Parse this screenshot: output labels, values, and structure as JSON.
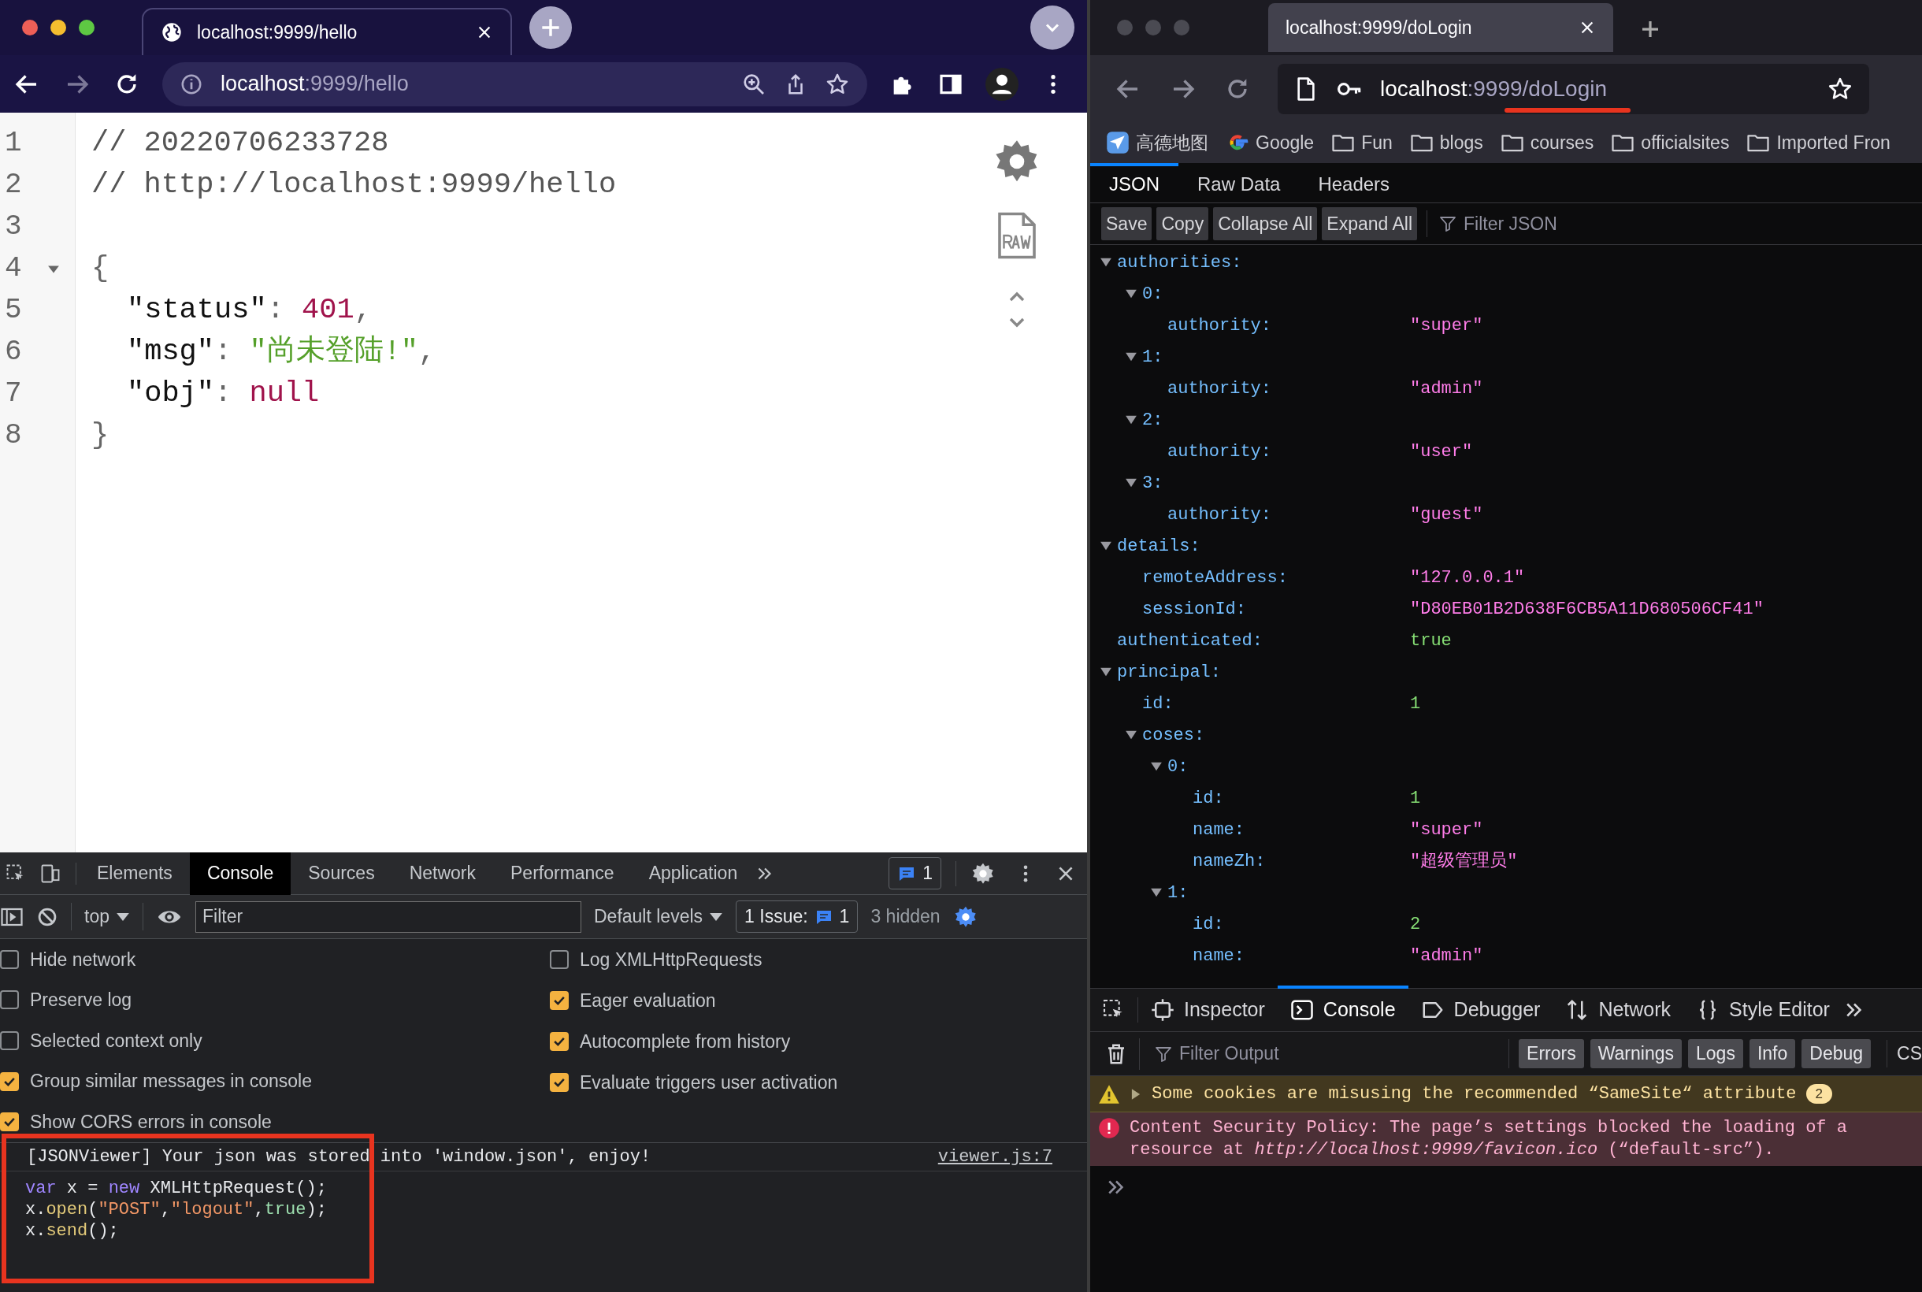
{
  "left_browser": {
    "tab": {
      "title": "localhost:9999/hello"
    },
    "address": {
      "host": "localhost",
      "path": ":9999/hello"
    },
    "viewer": {
      "lines": [
        {
          "number": "1",
          "foldable": false,
          "indented": false,
          "tokens": [
            {
              "kind": "comment",
              "text": "// 20220706233728"
            }
          ]
        },
        {
          "number": "2",
          "foldable": false,
          "indented": false,
          "tokens": [
            {
              "kind": "comment",
              "text": "// http://localhost:9999/hello"
            }
          ]
        },
        {
          "number": "3",
          "foldable": false
        },
        {
          "number": "4",
          "foldable": true,
          "indented": false,
          "tokens": [
            {
              "kind": "punct",
              "text": "{"
            }
          ]
        },
        {
          "number": "5",
          "foldable": false,
          "indented": true,
          "tokens": [
            {
              "kind": "key",
              "text": "\"status\""
            },
            {
              "kind": "punct",
              "text": ": "
            },
            {
              "kind": "number",
              "text": "401"
            },
            {
              "kind": "punct",
              "text": ","
            }
          ]
        },
        {
          "number": "6",
          "foldable": false,
          "indented": true,
          "tokens": [
            {
              "kind": "key",
              "text": "\"msg\""
            },
            {
              "kind": "punct",
              "text": ": "
            },
            {
              "kind": "string",
              "text": "\"尚未登陆!\""
            },
            {
              "kind": "punct",
              "text": ","
            }
          ]
        },
        {
          "number": "7",
          "foldable": false,
          "indented": true,
          "tokens": [
            {
              "kind": "key",
              "text": "\"obj\""
            },
            {
              "kind": "punct",
              "text": ": "
            },
            {
              "kind": "null",
              "text": "null"
            }
          ]
        },
        {
          "number": "8",
          "foldable": false,
          "indented": false,
          "tokens": [
            {
              "kind": "punct",
              "text": "}"
            }
          ]
        }
      ]
    },
    "devtools": {
      "tabs": [
        {
          "label": "Elements",
          "selected": false
        },
        {
          "label": "Console",
          "selected": true
        },
        {
          "label": "Sources",
          "selected": false
        },
        {
          "label": "Network",
          "selected": false
        },
        {
          "label": "Performance",
          "selected": false
        },
        {
          "label": "Application",
          "selected": false
        }
      ],
      "message_badge": "1",
      "context": "top",
      "filter_placeholder": "Filter",
      "levels": "Default levels",
      "issues_label": "1 Issue:",
      "issues_count": "1",
      "hidden": "3 hidden",
      "settings_left": [
        {
          "label": "Hide network",
          "checked": false
        },
        {
          "label": "Preserve log",
          "checked": false
        },
        {
          "label": "Selected context only",
          "checked": false
        },
        {
          "label": "Group similar messages in console",
          "checked": true
        },
        {
          "label": "Show CORS errors in console",
          "checked": true
        }
      ],
      "settings_right": [
        {
          "label": "Log XMLHttpRequests",
          "checked": false
        },
        {
          "label": "Eager evaluation",
          "checked": true
        },
        {
          "label": "Autocomplete from history",
          "checked": true
        },
        {
          "label": "Evaluate triggers user activation",
          "checked": true
        }
      ],
      "messages": [
        {
          "text": "[JSONViewer] Your json was stored into 'window.json', enjoy!",
          "source": "viewer.js:7"
        }
      ],
      "input_lines": [
        [
          {
            "kind": "keyword",
            "text": "var"
          },
          {
            "kind": "plain",
            "text": " x = "
          },
          {
            "kind": "keyword",
            "text": "new"
          },
          {
            "kind": "plain",
            "text": " XMLHttpRequest();"
          }
        ],
        [
          {
            "kind": "plain",
            "text": "x."
          },
          {
            "kind": "method",
            "text": "open"
          },
          {
            "kind": "plain",
            "text": "("
          },
          {
            "kind": "string",
            "text": "\"POST\""
          },
          {
            "kind": "plain",
            "text": ","
          },
          {
            "kind": "string",
            "text": "\"logout\""
          },
          {
            "kind": "plain",
            "text": ","
          },
          {
            "kind": "bool",
            "text": "true"
          },
          {
            "kind": "plain",
            "text": ");"
          }
        ],
        [
          {
            "kind": "plain",
            "text": "x."
          },
          {
            "kind": "method",
            "text": "send"
          },
          {
            "kind": "plain",
            "text": "();"
          }
        ]
      ]
    }
  },
  "right_browser": {
    "tab": {
      "title": "localhost:9999/doLogin"
    },
    "address": {
      "host": "localhost",
      "path": ":9999/doLogin"
    },
    "bookmarks": [
      {
        "label": "高德地图",
        "kind": "map"
      },
      {
        "label": "Google",
        "kind": "google"
      },
      {
        "label": "Fun",
        "kind": "folder"
      },
      {
        "label": "blogs",
        "kind": "folder"
      },
      {
        "label": "courses",
        "kind": "folder"
      },
      {
        "label": "officialsites",
        "kind": "folder"
      },
      {
        "label": "Imported Fron",
        "kind": "folder"
      }
    ],
    "viewer_tabs": [
      {
        "label": "JSON",
        "selected": true
      },
      {
        "label": "Raw Data",
        "selected": false
      },
      {
        "label": "Headers",
        "selected": false
      }
    ],
    "viewer_buttons": [
      "Save",
      "Copy",
      "Collapse All",
      "Expand All"
    ],
    "filter_placeholder": "Filter JSON",
    "tree": [
      {
        "key": "authorities:",
        "expanded": true,
        "children": [
          {
            "key": "0:",
            "expanded": true,
            "children": [
              {
                "key": "authority:",
                "value": "\"super\"",
                "kind": "string"
              }
            ]
          },
          {
            "key": "1:",
            "expanded": true,
            "children": [
              {
                "key": "authority:",
                "value": "\"admin\"",
                "kind": "string"
              }
            ]
          },
          {
            "key": "2:",
            "expanded": true,
            "children": [
              {
                "key": "authority:",
                "value": "\"user\"",
                "kind": "string"
              }
            ]
          },
          {
            "key": "3:",
            "expanded": true,
            "children": [
              {
                "key": "authority:",
                "value": "\"guest\"",
                "kind": "string"
              }
            ]
          }
        ]
      },
      {
        "key": "details:",
        "expanded": true,
        "children": [
          {
            "key": "remoteAddress:",
            "value": "\"127.0.0.1\"",
            "kind": "string"
          },
          {
            "key": "sessionId:",
            "value": "\"D80EB01B2D638F6CB5A11D680506CF41\"",
            "kind": "string"
          }
        ]
      },
      {
        "key": "authenticated:",
        "value": "true",
        "kind": "boolean"
      },
      {
        "key": "principal:",
        "expanded": true,
        "children": [
          {
            "key": "id:",
            "value": "1",
            "kind": "number"
          },
          {
            "key": "coses:",
            "expanded": true,
            "children": [
              {
                "key": "0:",
                "expanded": true,
                "children": [
                  {
                    "key": "id:",
                    "value": "1",
                    "kind": "number"
                  },
                  {
                    "key": "name:",
                    "value": "\"super\"",
                    "kind": "string"
                  },
                  {
                    "key": "nameZh:",
                    "value": "\"超级管理员\"",
                    "kind": "string"
                  }
                ]
              },
              {
                "key": "1:",
                "expanded": true,
                "children": [
                  {
                    "key": "id:",
                    "value": "2",
                    "kind": "number"
                  },
                  {
                    "key": "name:",
                    "value": "\"admin\"",
                    "kind": "string"
                  }
                ]
              }
            ]
          }
        ]
      }
    ],
    "devtools": {
      "tabs": [
        {
          "label": "Inspector",
          "selected": false
        },
        {
          "label": "Console",
          "selected": true
        },
        {
          "label": "Debugger",
          "selected": false
        },
        {
          "label": "Network",
          "selected": false
        },
        {
          "label": "Style Editor",
          "selected": false
        }
      ],
      "filter_placeholder": "Filter Output",
      "filters": [
        "Errors",
        "Warnings",
        "Logs",
        "Info",
        "Debug"
      ],
      "filter_cut": "CS",
      "messages": [
        {
          "kind": "warning",
          "text": "Some cookies are misusing the recommended “SameSite“ attribute",
          "count": "2"
        },
        {
          "kind": "error",
          "text": "Content Security Policy: The page’s settings blocked the loading of a resource at *http://localhost:9999/favicon.ico* (“default-src”)."
        }
      ]
    }
  }
}
